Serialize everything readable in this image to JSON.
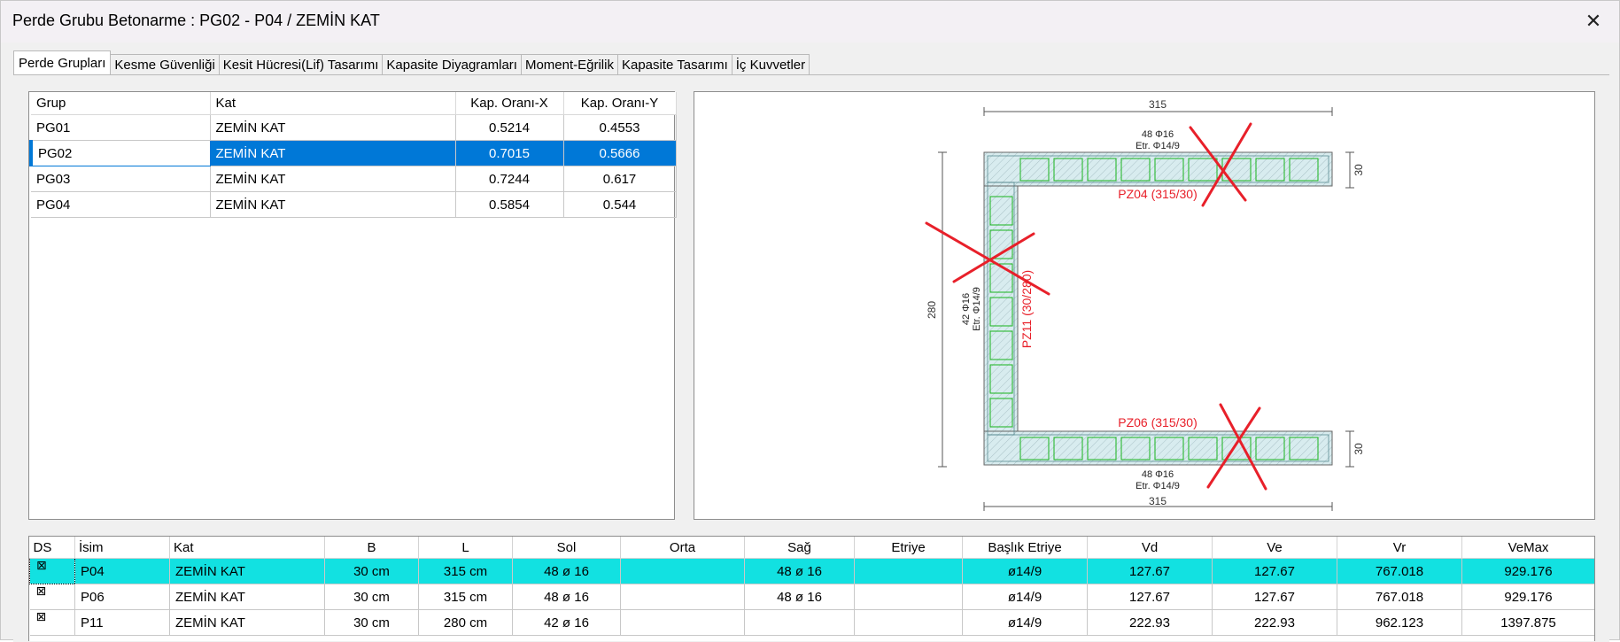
{
  "window": {
    "title": "Perde Grubu Betonarme  :  PG02 - P04 / ZEMİN KAT",
    "close_glyph": "✕"
  },
  "tabs": [
    {
      "label": "Perde Grupları",
      "active": true
    },
    {
      "label": "Kesme Güvenliği"
    },
    {
      "label": "Kesit Hücresi(Lif) Tasarımı"
    },
    {
      "label": "Kapasite Diyagramları"
    },
    {
      "label": "Moment-Eğrilik"
    },
    {
      "label": "Kapasite Tasarımı"
    },
    {
      "label": "İç Kuvvetler"
    }
  ],
  "groups_table": {
    "headers": [
      "Grup",
      "Kat",
      "Kap. Oranı-X",
      "Kap. Oranı-Y"
    ],
    "rows": [
      [
        "PG01",
        "ZEMİN KAT",
        "0.5214",
        "0.4553"
      ],
      [
        "PG02",
        "ZEMİN KAT",
        "0.7015",
        "0.5666"
      ],
      [
        "PG03",
        "ZEMİN KAT",
        "0.7244",
        "0.617"
      ],
      [
        "PG04",
        "ZEMİN KAT",
        "0.5854",
        "0.544"
      ]
    ],
    "selected_row": 1
  },
  "drawing": {
    "dim_top": "315",
    "dim_bottom": "315",
    "dim_left": "280",
    "dim_right_top": "30",
    "dim_right_bottom": "30",
    "top_rebar": "48 Φ16",
    "top_stirrup": "Etr. Φ14/9",
    "top_label": "PZ04 (315/30)",
    "bottom_label": "PZ06 (315/30)",
    "bottom_rebar": "48 Φ16",
    "bottom_stirrup": "Etr. Φ14/9",
    "left_rebar": "42 Φ16",
    "left_stirrup": "Etr. Φ14/9",
    "left_label": "PZ11 (30/280)",
    "label_color": "#e8202a",
    "cross_color": "#e8202a",
    "fill_color": "#d8ecef",
    "stirrup_color": "#19b31e"
  },
  "walls_table": {
    "headers": [
      "DS",
      "İsim",
      "Kat",
      "B",
      "L",
      "Sol",
      "Orta",
      "Sağ",
      "Etriye",
      "Başlık Etriye",
      "Vd",
      "Ve",
      "Vr",
      "VeMax"
    ],
    "check_glyph": "⊠",
    "rows": [
      [
        "",
        "P04",
        "ZEMİN KAT",
        "30 cm",
        "315 cm",
        "48 ø 16",
        "",
        "48 ø 16",
        "",
        "ø14/9",
        "127.67",
        "127.67",
        "767.018",
        "929.176"
      ],
      [
        "",
        "P06",
        "ZEMİN KAT",
        "30 cm",
        "315 cm",
        "48 ø 16",
        "",
        "48 ø 16",
        "",
        "ø14/9",
        "127.67",
        "127.67",
        "767.018",
        "929.176"
      ],
      [
        "",
        "P11",
        "ZEMİN KAT",
        "30 cm",
        "280 cm",
        "42 ø 16",
        "",
        "",
        "",
        "ø14/9",
        "222.93",
        "222.93",
        "962.123",
        "1397.875"
      ]
    ],
    "highlight_row": 0,
    "highlight_color": "#12e1e1"
  }
}
